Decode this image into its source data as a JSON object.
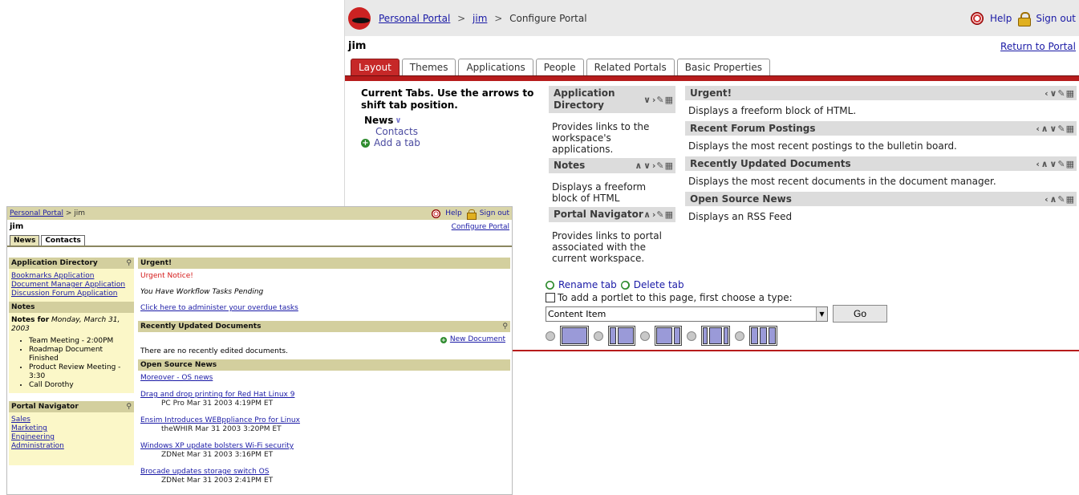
{
  "configure_window": {
    "breadcrumb": {
      "root": "Personal Portal",
      "user": "jim",
      "current": "Configure Portal",
      "sep": ">"
    },
    "help_label": "Help",
    "signout_label": "Sign out",
    "username": "jim",
    "return_link": "Return to Portal",
    "tabs": [
      "Layout",
      "Themes",
      "Applications",
      "People",
      "Related Portals",
      "Basic Properties"
    ],
    "active_tab": "Layout",
    "current_tabs_header": "Current Tabs. Use the arrows to shift tab position.",
    "tab_list": {
      "current": "News",
      "other": "Contacts",
      "add": "Add a tab"
    },
    "column1": [
      {
        "title": "Application Directory",
        "icons": "∨ ›",
        "desc": "Provides links to the workspace's applications."
      },
      {
        "title": "Notes",
        "icons": "∧ ∨ ›",
        "desc": "Displays a freeform block of HTML"
      },
      {
        "title": "Portal Navigator",
        "icons": "∧ ›",
        "desc": "Provides links to portal associated with the current workspace."
      }
    ],
    "column2": [
      {
        "title": "Urgent!",
        "icons": "‹ ∨",
        "desc": "Displays a freeform block of HTML."
      },
      {
        "title": "Recent Forum Postings",
        "icons": "‹ ∧ ∨",
        "desc": "Displays the most recent postings to the bulletin board."
      },
      {
        "title": "Recently Updated Documents",
        "icons": "‹ ∧ ∨",
        "desc": "Displays the most recent documents in the document manager."
      },
      {
        "title": "Open Source News",
        "icons": "‹ ∧",
        "desc": "Displays an RSS Feed"
      }
    ],
    "rename_tab": "Rename tab",
    "delete_tab": "Delete tab",
    "add_portlet_text": "To add a portlet to this page, first choose a type:",
    "portlet_type_selected": "Content Item",
    "go_label": "Go"
  },
  "portal_window": {
    "breadcrumb": {
      "root": "Personal Portal",
      "user": "jim",
      "sep": ">"
    },
    "help_label": "Help",
    "signout_label": "Sign out",
    "username": "jim",
    "configure_link": "Configure Portal",
    "tabs": [
      "News",
      "Contacts"
    ],
    "app_directory": {
      "title": "Application Directory",
      "links": [
        "Bookmarks Application",
        "Document Manager Application",
        "Discussion Forum Application"
      ]
    },
    "notes": {
      "title": "Notes",
      "notes_for_label": "Notes for",
      "date": "Monday, March 31, 2003",
      "items": [
        "Team Meeting - 2:00PM",
        "Roadmap Document Finished",
        "Product Review Meeting - 3:30",
        "Call Dorothy"
      ]
    },
    "portal_navigator": {
      "title": "Portal Navigator",
      "links": [
        "Sales",
        "Marketing",
        "Engineering",
        "Administration"
      ]
    },
    "urgent": {
      "title": "Urgent!",
      "notice": "Urgent Notice!",
      "message": "You Have Workflow Tasks Pending",
      "link": "Click here to administer your overdue tasks"
    },
    "recent_docs": {
      "title": "Recently Updated Documents",
      "new_doc": "New Document",
      "empty": "There are no recently edited documents."
    },
    "open_source_news": {
      "title": "Open Source News",
      "source_link": "Moreover - OS news",
      "items": [
        {
          "title": "Drag and drop printing for Red Hat Linux 9",
          "meta": "PC Pro Mar 31 2003 4:19PM ET"
        },
        {
          "title": "Ensim Introduces WEBppliance Pro for Linux",
          "meta": "theWHIR Mar 31 2003 3:20PM ET"
        },
        {
          "title": "Windows XP update bolsters Wi-Fi security",
          "meta": "ZDNet Mar 31 2003 3:16PM ET"
        },
        {
          "title": "Brocade updates storage switch OS",
          "meta": "ZDNet Mar 31 2003 2:41PM ET"
        }
      ]
    }
  },
  "colors": {
    "accent_red": "#b71c1c",
    "portal_khaki": "#d9d5a8",
    "portal_sidebar": "#fbf7c8",
    "link_blue": "#1a1aa6"
  }
}
